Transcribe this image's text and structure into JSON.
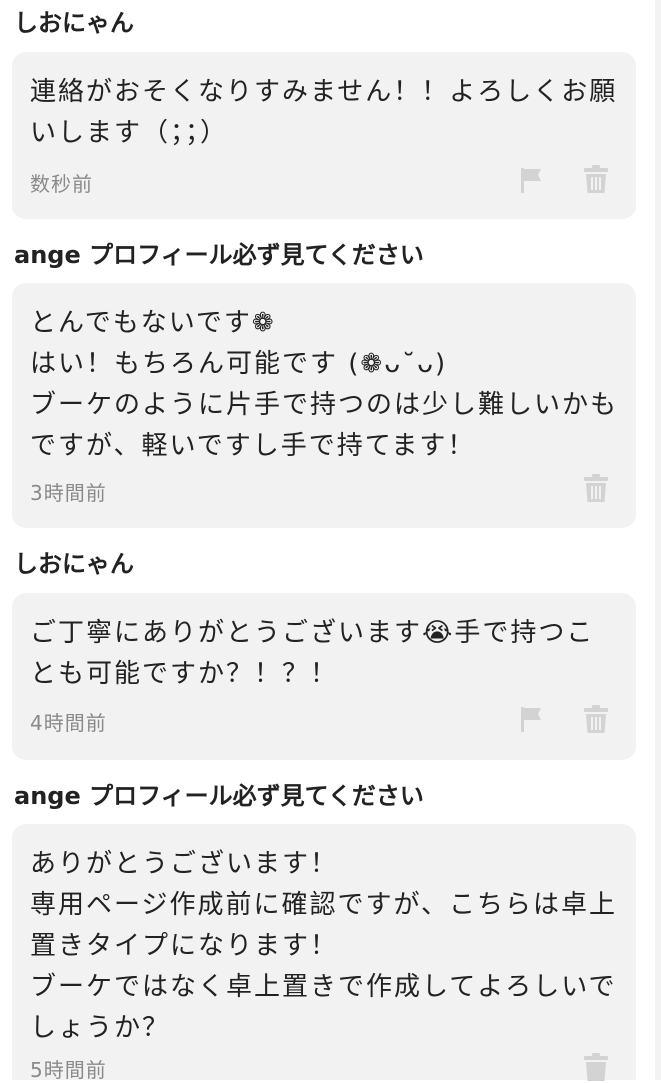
{
  "messages": [
    {
      "sender": "しおにゃん",
      "text": "連絡がおそくなりすみません！！よろしくお願いします（；；）",
      "time": "数秒前",
      "icons": [
        "flag-icon",
        "trash-icon"
      ]
    },
    {
      "sender": "ange プロフィール必ず見てください",
      "text": "とんでもないです❁\nはい！もちろん可能です (❁ᴗ˘ᴗ)\nブーケのように片手で持つのは少し難しいかもですが、軽いですし手で持てます！",
      "time": "3時間前",
      "icons": [
        "trash-icon"
      ]
    },
    {
      "sender": "しおにゃん",
      "text": "ご丁寧にありがとうございます😭手で持つことも可能ですか？！？！",
      "time": "4時間前",
      "icons": [
        "flag-icon",
        "trash-icon"
      ]
    },
    {
      "sender": "ange プロフィール必ず見てください",
      "text": "ありがとうございます！\n専用ページ作成前に確認ですが、こちらは卓上置きタイプになります！\nブーケではなく卓上置きで作成してよろしいでしょうか？",
      "time": "5時間前",
      "icons": [
        "trash-icon"
      ]
    }
  ],
  "colors": {
    "bubble": "#f2f2f2",
    "icon": "#d3d3d3",
    "timestamp": "#8a8a8a"
  }
}
